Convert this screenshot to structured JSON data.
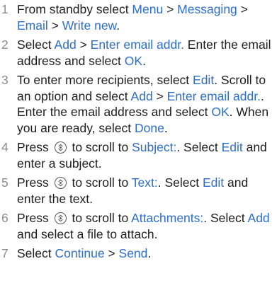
{
  "steps": [
    {
      "num": "1",
      "parts": [
        {
          "t": "From standby select "
        },
        {
          "t": "Menu",
          "link": true
        },
        {
          "t": " > "
        },
        {
          "t": "Messaging",
          "link": true
        },
        {
          "t": " > "
        },
        {
          "t": "Email",
          "link": true
        },
        {
          "t": " > "
        },
        {
          "t": "Write new",
          "link": true
        },
        {
          "t": "."
        }
      ]
    },
    {
      "num": "2",
      "parts": [
        {
          "t": "Select "
        },
        {
          "t": "Add",
          "link": true
        },
        {
          "t": " > "
        },
        {
          "t": "Enter email addr.",
          "link": true
        },
        {
          "t": " Enter the email address and select "
        },
        {
          "t": "OK",
          "link": true
        },
        {
          "t": "."
        }
      ]
    },
    {
      "num": "3",
      "parts": [
        {
          "t": "To enter more recipients, select "
        },
        {
          "t": "Edit",
          "link": true
        },
        {
          "t": ". Scroll to an option and select "
        },
        {
          "t": "Add",
          "link": true
        },
        {
          "t": " > "
        },
        {
          "t": "Enter email addr.",
          "link": true
        },
        {
          "t": ". Enter the email address and select "
        },
        {
          "t": "OK",
          "link": true
        },
        {
          "t": ". When you are ready, select "
        },
        {
          "t": "Done",
          "link": true
        },
        {
          "t": "."
        }
      ]
    },
    {
      "num": "4",
      "parts": [
        {
          "t": "Press "
        },
        {
          "icon": "navigation-key-icon"
        },
        {
          "t": " to scroll to "
        },
        {
          "t": "Subject:",
          "link": true
        },
        {
          "t": ". Select "
        },
        {
          "t": "Edit",
          "link": true
        },
        {
          "t": " and enter a subject."
        }
      ]
    },
    {
      "num": "5",
      "parts": [
        {
          "t": "Press "
        },
        {
          "icon": "navigation-key-icon"
        },
        {
          "t": " to scroll to "
        },
        {
          "t": "Text:",
          "link": true
        },
        {
          "t": ". Select "
        },
        {
          "t": "Edit",
          "link": true
        },
        {
          "t": " and enter the text."
        }
      ]
    },
    {
      "num": "6",
      "parts": [
        {
          "t": "Press "
        },
        {
          "icon": "navigation-key-icon"
        },
        {
          "t": " to scroll to "
        },
        {
          "t": "Attachments:",
          "link": true
        },
        {
          "t": ". Select "
        },
        {
          "t": "Add",
          "link": true
        },
        {
          "t": " and select a file to attach."
        }
      ]
    },
    {
      "num": "7",
      "parts": [
        {
          "t": "Select "
        },
        {
          "t": "Continue",
          "link": true
        },
        {
          "t": " > "
        },
        {
          "t": "Send",
          "link": true
        },
        {
          "t": "."
        }
      ]
    }
  ]
}
